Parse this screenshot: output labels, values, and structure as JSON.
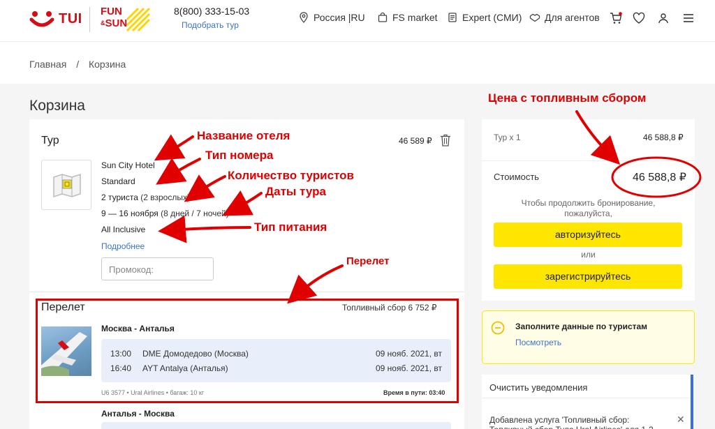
{
  "header": {
    "logo_tui": "TUI",
    "logo_fun_line1": "FUN",
    "logo_fun_line2": "&",
    "logo_fun_line3": "SUN",
    "phone": "8(800) 333-15-03",
    "pick_tour": "Подобрать тур",
    "nav": [
      {
        "label": "Россия |RU",
        "icon": "location-pin-icon"
      },
      {
        "label": "FS market",
        "icon": "shopping-bag-icon"
      },
      {
        "label": "Expert (СМИ)",
        "icon": "news-icon"
      },
      {
        "label": "Для агентов",
        "icon": "handshake-icon"
      }
    ],
    "colors": {
      "brand_red": "#d40e14",
      "brand_yellow": "#ffe600",
      "link_blue": "#3b73c9"
    }
  },
  "breadcrumb": [
    "Главная",
    "/",
    "Корзина"
  ],
  "page_title": "Корзина",
  "tour": {
    "label": "Тур",
    "price": "46 589 ₽",
    "hotel": "Sun City Hotel",
    "room": "Standard",
    "tourists_main": "2 туриста",
    "tourists_detail": " (2 взрослых)",
    "dates_main": "9 — 16 ноября",
    "dates_detail": " (8 дней / 7 ночей)",
    "meal": "All Inclusive",
    "more": "Подробнее",
    "promo_placeholder": "Промокод:"
  },
  "flight": {
    "label": "Перелет",
    "fuel": "Топливный сбор 6 752 ₽",
    "route_out": "Москва - Анталья",
    "segments": [
      {
        "time": "13:00",
        "airport": "DME Домодедово (Москва)",
        "date": "09 нояб. 2021, вт"
      },
      {
        "time": "16:40",
        "airport": "AYT Antalya (Анталья)",
        "date": "09 нояб. 2021, вт"
      }
    ],
    "meta": "U6 3577 • Ural Airlines • багаж: 10 кг",
    "duration": "Время в пути: 03:40",
    "route_back": "Анталья - Москва"
  },
  "summary": {
    "tour_count": "Тур x 1",
    "tour_sum": "46 588,8 ₽",
    "cost_label": "Стоимость",
    "cost_value": "46 588,8 ₽",
    "continue_text_1": "Чтобы продолжить бронирование,",
    "continue_text_2": "пожалуйста,",
    "auth_button": "авторизуйтесь",
    "or": "или",
    "register_button": "зарегистрируйтесь"
  },
  "notice": {
    "title": "Заполните данные по туристам",
    "link": "Посмотреть"
  },
  "notifications": {
    "clear": "Очистить уведомления",
    "message": "Добавлена услуга 'Топливный сбор: Топливный сбор Тула Ural Airlines' для 1-2"
  },
  "annotations": {
    "fuel_price": "Цена с топливным сбором",
    "hotel_name": "Название отеля",
    "room_type": "Тип номера",
    "tourists_count": "Количество туристов",
    "tour_dates": "Даты тура",
    "meal_type": "Тип питания",
    "flight": "Перелет"
  }
}
